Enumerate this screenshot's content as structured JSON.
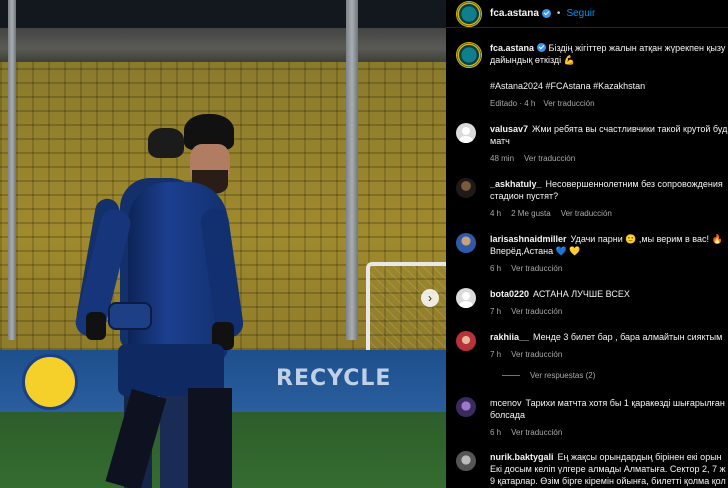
{
  "post": {
    "username": "fca.astana",
    "follow_label": "Seguir",
    "caption_lines": [
      "Біздің жігіттер жалын атқан жүрекпен қызу",
      "дайындық өткізді 💪"
    ],
    "hashtags": "#Astana2024 #FCAstana #Kazakhstan",
    "edited": "Editado · 4 h",
    "see_translation": "Ver traducción"
  },
  "photo": {
    "ad_text": "RECYCLE",
    "next_icon": "chevron-right-icon"
  },
  "comments": [
    {
      "user": "valusav7",
      "lines": [
        "Жми ребята вы счастливчики такой крутой буд",
        "матч"
      ],
      "time": "48 min",
      "likes": "",
      "translate": "Ver traducción",
      "avatar": "default"
    },
    {
      "user": "_askhatuly_",
      "lines": [
        "Несовершеннолетним без сопровождения",
        "стадион пустят?"
      ],
      "time": "4 h",
      "likes": "2 Me gusta",
      "translate": "Ver traducción",
      "avatar": "photo-dark"
    },
    {
      "user": "larisashnaidmiller",
      "lines": [
        "Удачи парни 🙂 ,мы верим в вас! 🔥",
        "Вперёд,Астана 💙 💛"
      ],
      "time": "6 h",
      "likes": "",
      "translate": "Ver traducción",
      "avatar": "photo-blue"
    },
    {
      "user": "bota0220",
      "lines": [
        "АСТАНА ЛУЧШЕ ВСЕХ"
      ],
      "time": "7 h",
      "likes": "",
      "translate": "Ver traducción",
      "avatar": "default"
    },
    {
      "user": "rakhiia__",
      "lines": [
        "Менде 3 билет бар , бара алмайтын сияктым"
      ],
      "time": "7 h",
      "likes": "",
      "translate": "Ver traducción",
      "avatar": "photo-red"
    },
    {
      "user": "mcenov",
      "lines": [
        "Тарихи матчта хотя бы 1 қаракөзді шығарылған",
        "болсада"
      ],
      "time": "6 h",
      "likes": "",
      "translate": "Ver traducción",
      "avatar": "photo-purple"
    },
    {
      "user": "nurik.baktygali",
      "lines": [
        "Ең жақсы орындардың бірінен екі орын",
        "Екі досым келіп үлгере алмады Алматыға. Сектор 2, 7 ж",
        "9 қатарлар. Өзім бірге кіремін ойынға, билетті қолма қол"
      ],
      "time": "",
      "likes": "",
      "translate": "",
      "avatar": "photo-grey"
    }
  ],
  "replies_label": "Ver respuestas (2)"
}
